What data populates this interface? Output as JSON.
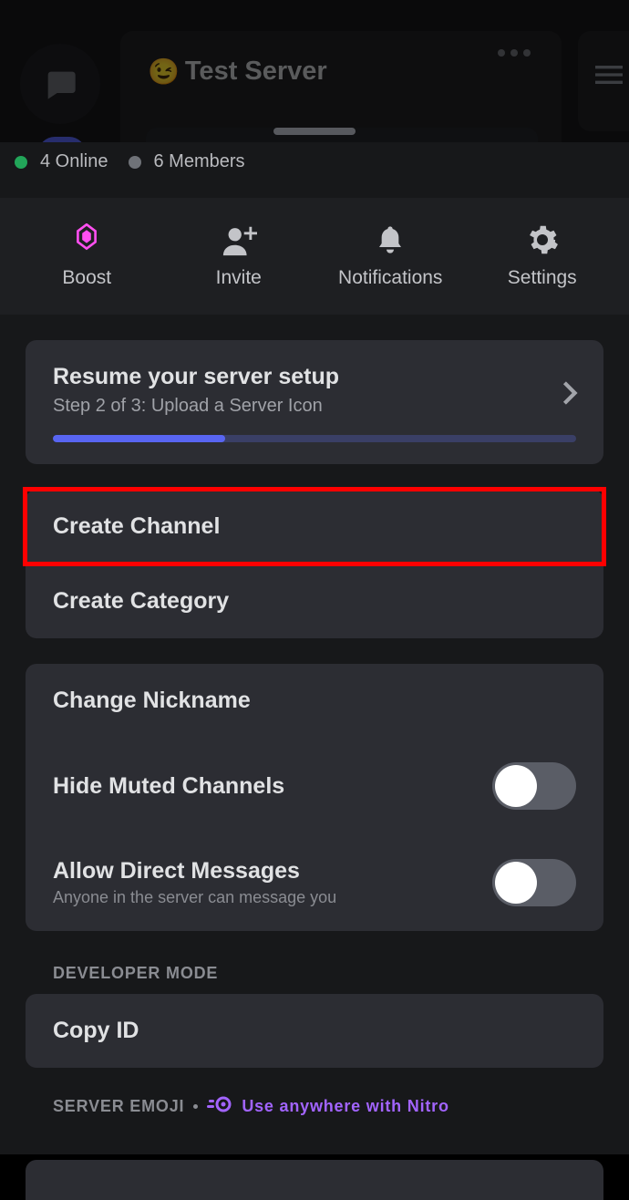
{
  "server": {
    "emoji": "😉",
    "name": "Test Server"
  },
  "presence": {
    "online_count": "4 Online",
    "members_count": "6 Members"
  },
  "actions": {
    "boost": "Boost",
    "invite": "Invite",
    "notifications": "Notifications",
    "settings": "Settings"
  },
  "setup": {
    "title": "Resume your server setup",
    "step": "Step 2 of 3: Upload a Server Icon",
    "progress_percent": 33
  },
  "menu": {
    "create_channel": "Create Channel",
    "create_category": "Create Category",
    "change_nickname": "Change Nickname",
    "hide_muted": "Hide Muted Channels",
    "allow_dm": "Allow Direct Messages",
    "allow_dm_sub": "Anyone in the server can message you",
    "copy_id": "Copy ID"
  },
  "sections": {
    "developer_mode": "DEVELOPER MODE",
    "server_emoji": "SERVER EMOJI",
    "nitro": "Use anywhere with Nitro"
  }
}
